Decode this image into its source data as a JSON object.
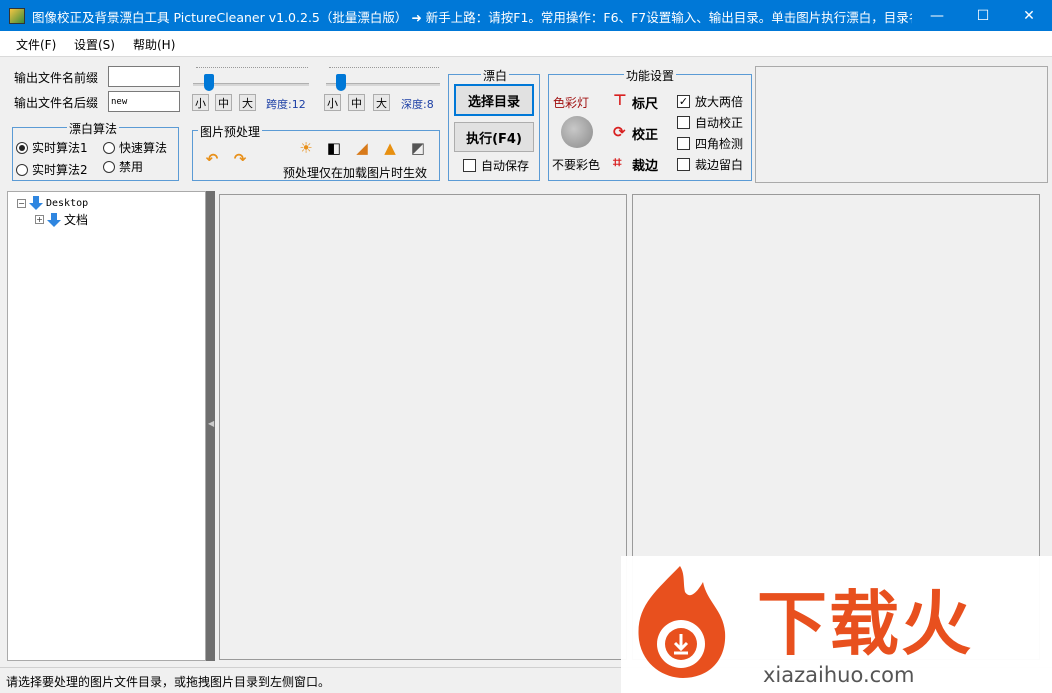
{
  "window": {
    "title": "图像校正及背景漂白工具 PictureCleaner v1.0.2.5（批量漂白版） ➜ 新手上路：请按F1。常用操作：F6、F7设置输入、输出目录。单击图片执行漂白，目录名回车...",
    "minimize": "—",
    "maximize": "☐",
    "close": "✕"
  },
  "menu": [
    "文件(F)",
    "设置(S)",
    "帮助(H)"
  ],
  "output": {
    "prefix_label": "输出文件名前缀",
    "prefix_value": "",
    "suffix_label": "输出文件名后缀",
    "suffix_value": "new"
  },
  "sliders": {
    "span": {
      "size_labels": [
        "小",
        "中",
        "大"
      ],
      "label": "跨度:12",
      "level": 0.1
    },
    "depth": {
      "size_labels": [
        "小",
        "中",
        "大"
      ],
      "label": "深度:8",
      "level": 0.1
    }
  },
  "algorithm": {
    "title": "漂白算法",
    "options": [
      "实时算法1",
      "快速算法",
      "实时算法2",
      "禁用"
    ],
    "selected": "实时算法1"
  },
  "preprocess": {
    "title": "图片预处理",
    "note": "预处理仅在加载图片时生效",
    "icons": [
      "undo-icon",
      "redo-icon",
      "brightness-icon",
      "contrast-icon",
      "levels-icon",
      "sharpen-icon",
      "color-replace-icon"
    ]
  },
  "bleach": {
    "title": "漂白",
    "select_dir": "选择目录",
    "execute": "执行(F4)",
    "autosave": "自动保存",
    "autosave_checked": false
  },
  "functions": {
    "title": "功能设置",
    "color_light": "色彩灯",
    "no_color": "不要彩色",
    "ruler": "标尺",
    "correct": "校正",
    "crop": "裁边",
    "checks": [
      {
        "label": "放大两倍",
        "checked": true
      },
      {
        "label": "自动校正",
        "checked": false
      },
      {
        "label": "四角检测",
        "checked": false
      },
      {
        "label": "裁边留白",
        "checked": false
      }
    ]
  },
  "tree": {
    "root": "Desktop",
    "child": "文档"
  },
  "status": "请选择要处理的图片文件目录，或拖拽图片目录到左侧窗口。",
  "watermark": {
    "brand": "下载火",
    "url": "xiazaihuo.com"
  },
  "colors": {
    "title_bar": "#0078d7",
    "group_border": "#5b9bd5",
    "accent_red": "#d82020",
    "watermark_orange": "#e8501e"
  }
}
